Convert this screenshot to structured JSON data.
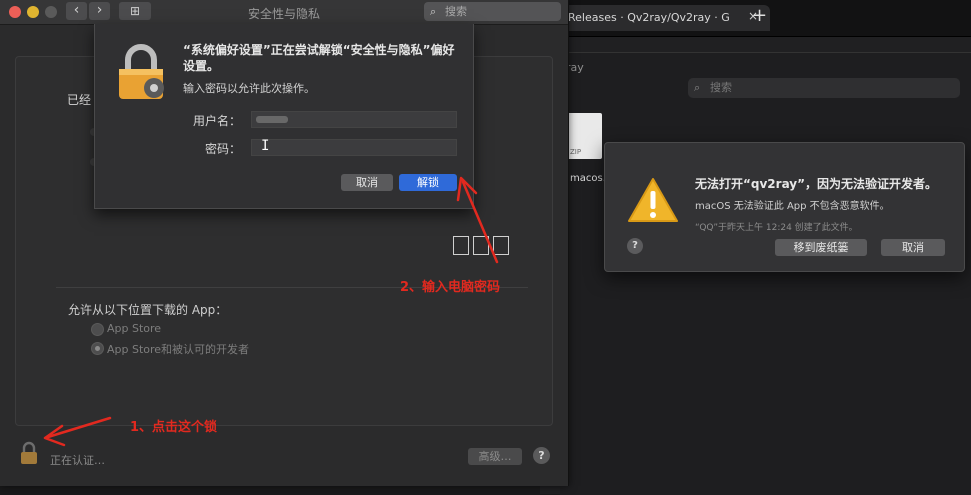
{
  "browser": {
    "tab_title": "Releases · Qv2ray/Qv2ray · G",
    "close_glyph": "×",
    "new_tab_glyph": "+",
    "finder_crumb": "ray",
    "finder_search_placeholder": "搜索",
    "zip_label": "ZIP",
    "file_name": "macos."
  },
  "prefs": {
    "window_title": "安全性与隐私",
    "search_placeholder": "搜索",
    "back_glyph": "‹",
    "forward_glyph": "›",
    "grid_glyph": "⊞",
    "already_label": "已经",
    "allow_label": "允许从以下位置下载的 App：",
    "radio_options": [
      "App Store",
      "App Store和被认可的开发者"
    ],
    "auth_status": "正在认证…",
    "advanced_label": "高级…",
    "help_label": "?"
  },
  "auth_dialog": {
    "message": "“系统偏好设置”正在尝试解锁“安全性与隐私”偏好设置。",
    "sub": "输入密码以允许此次操作。",
    "username_label": "用户名：",
    "password_label": "密码：",
    "cursor_glyph": "I",
    "cancel_label": "取消",
    "unlock_label": "解锁"
  },
  "warning_dialog": {
    "title": "无法打开“qv2ray”，因为无法验证开发者。",
    "body": "macOS 无法验证此 App 不包含恶意软件。",
    "note": "“QQ”于昨天上午 12:24 创建了此文件。",
    "help_label": "?",
    "trash_label": "移到废纸篓",
    "cancel_label": "取消"
  },
  "annotations": {
    "step1": "1、点击这个锁",
    "step2": "2、输入电脑密码"
  },
  "colors": {
    "annotation_red": "#e2291f",
    "unlock_blue": "#2f6ad9",
    "close_red": "#ec5f57",
    "minimize_yellow": "#e0b530"
  }
}
